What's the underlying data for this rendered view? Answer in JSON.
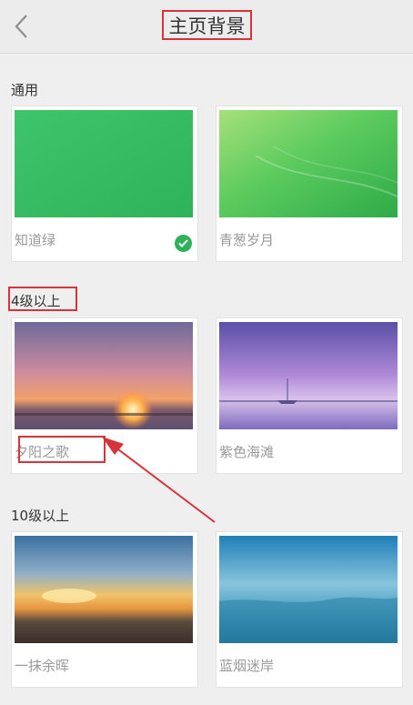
{
  "header": {
    "title": "主页背景",
    "back_icon": "chevron-left-icon"
  },
  "sections": [
    {
      "title": "通用",
      "items": [
        {
          "label": "知道绿",
          "selected": true
        },
        {
          "label": "青葱岁月",
          "selected": false
        }
      ]
    },
    {
      "title": "4级以上",
      "items": [
        {
          "label": "夕阳之歌",
          "selected": false
        },
        {
          "label": "紫色海滩",
          "selected": false
        }
      ]
    },
    {
      "title": "10级以上",
      "items": [
        {
          "label": "一抹余晖",
          "selected": false
        },
        {
          "label": "蓝烟迷岸",
          "selected": false
        }
      ]
    }
  ],
  "colors": {
    "accent_green": "#2db25a",
    "annotation_red": "#d9333a"
  }
}
